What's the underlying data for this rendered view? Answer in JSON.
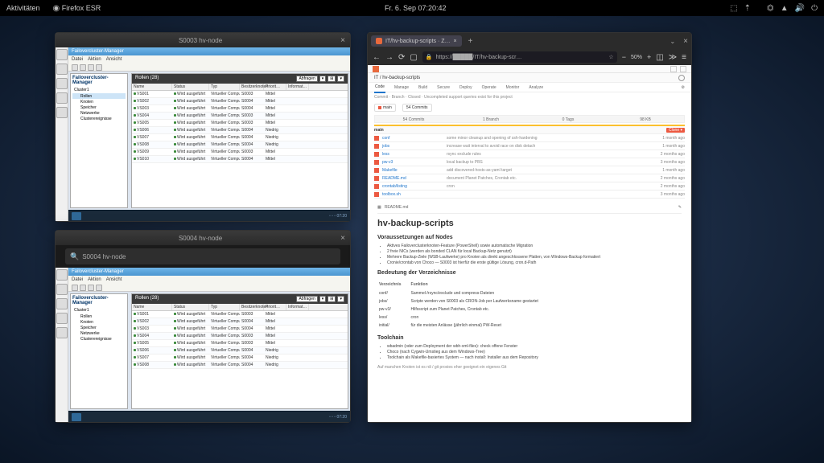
{
  "topbar": {
    "activities": "Aktivitäten",
    "app": "Firefox ESR",
    "datetime": "Fr. 6. Sep  07:20:42"
  },
  "hv1": {
    "title": "S0003 hv-node",
    "breadcrumb": "Failovercluster-Manager",
    "menu": [
      "Datei",
      "Aktion",
      "Ansicht"
    ],
    "tree_title": "Failovercluster-Manager",
    "tree": [
      "Cluster1",
      "Rollen",
      "Knoten",
      "Speicher",
      "Netzwerke",
      "Clusterereignisse"
    ],
    "list_title": "Rollen (28)",
    "filter": "Abfragen",
    "columns": [
      "Name",
      "Status",
      "Typ",
      "Besitzerknoten",
      "Priorit…",
      "Informat…"
    ],
    "rows": [
      [
        "VS001",
        "Wird ausgeführt",
        "Virtueller Computer",
        "S0003",
        "Mittel",
        ""
      ],
      [
        "VS002",
        "Wird ausgeführt",
        "Virtueller Computer",
        "S0004",
        "Mittel",
        ""
      ],
      [
        "VS003",
        "Wird ausgeführt",
        "Virtueller Computer",
        "S0004",
        "Mittel",
        ""
      ],
      [
        "VS004",
        "Wird ausgeführt",
        "Virtueller Computer",
        "S0003",
        "Mittel",
        ""
      ],
      [
        "VS005",
        "Wird ausgeführt",
        "Virtueller Computer",
        "S0003",
        "Mittel",
        ""
      ],
      [
        "VS006",
        "Wird ausgeführt",
        "Virtueller Computer",
        "S0004",
        "Niedrig",
        ""
      ],
      [
        "VS007",
        "Wird ausgeführt",
        "Virtueller Computer",
        "S0004",
        "Niedrig",
        ""
      ],
      [
        "VS008",
        "Wird ausgeführt",
        "Virtueller Computer",
        "S0004",
        "Niedrig",
        ""
      ],
      [
        "VS009",
        "Wird ausgeführt",
        "Virtueller Computer",
        "S0003",
        "Mittel",
        ""
      ],
      [
        "VS010",
        "Wird ausgeführt",
        "Virtueller Computer",
        "S0004",
        "Mittel",
        ""
      ]
    ]
  },
  "hv2": {
    "title": "S0004 hv-node",
    "search": "S0004 hv-node",
    "breadcrumb": "Failovercluster-Manager",
    "menu": [
      "Datei",
      "Aktion",
      "Ansicht"
    ],
    "tree_title": "Failovercluster-Manager",
    "tree": [
      "Cluster1",
      "Rollen",
      "Knoten",
      "Speicher",
      "Netzwerke",
      "Clusterereignisse"
    ],
    "list_title": "Rollen (28)",
    "filter": "Abfragen",
    "columns": [
      "Name",
      "Status",
      "Typ",
      "Besitzerknoten",
      "Priorit…",
      "Informat…"
    ],
    "rows": [
      [
        "VS001",
        "Wird ausgeführt",
        "Virtueller Computer",
        "S0003",
        "Mittel",
        ""
      ],
      [
        "VS002",
        "Wird ausgeführt",
        "Virtueller Computer",
        "S0004",
        "Mittel",
        ""
      ],
      [
        "VS003",
        "Wird ausgeführt",
        "Virtueller Computer",
        "S0004",
        "Mittel",
        ""
      ],
      [
        "VS004",
        "Wird ausgeführt",
        "Virtueller Computer",
        "S0003",
        "Mittel",
        ""
      ],
      [
        "VS005",
        "Wird ausgeführt",
        "Virtueller Computer",
        "S0003",
        "Mittel",
        ""
      ],
      [
        "VS006",
        "Wird ausgeführt",
        "Virtueller Computer",
        "S0004",
        "Niedrig",
        ""
      ],
      [
        "VS007",
        "Wird ausgeführt",
        "Virtueller Computer",
        "S0004",
        "Niedrig",
        ""
      ],
      [
        "VS008",
        "Wird ausgeführt",
        "Virtueller Computer",
        "S0004",
        "Niedrig",
        ""
      ]
    ]
  },
  "firefox": {
    "tab_label": "IT/hv-backup-scripts · Z…",
    "url": "https://█████/IT/hv-backup-scr…",
    "zoom": "50%"
  },
  "gitlab": {
    "breadcrumb": "IT / hv-backup-scripts",
    "tabs": [
      "Code",
      "Manage",
      "Build",
      "Secure",
      "Deploy",
      "Operate",
      "Monitor",
      "Analyze"
    ],
    "active_tab": "Code",
    "subtext": "Commit · Branch · Closed · Uncompleted support queries exist for this project",
    "commits_label": "54 Commits",
    "branch_label": "1 Branch",
    "tags_label": "0 Tags",
    "storage_label": "98 KB",
    "main_branch": "main",
    "files": [
      {
        "name": "conf",
        "msg": "some minor cleanup and opening of ssh-hardening",
        "age": "1 month ago"
      },
      {
        "name": "jobs",
        "msg": "increase wait interval to avoid race on disk detach",
        "age": "1 month ago"
      },
      {
        "name": "less",
        "msg": "rsync exclude rules",
        "age": "2 months ago"
      },
      {
        "name": "pw-v3",
        "msg": "local backup to PBS",
        "age": "3 months ago"
      },
      {
        "name": "Makefile",
        "msg": "add discovered-hosts-as-yaml target",
        "age": "1 month ago"
      },
      {
        "name": "README.md",
        "msg": "document Planet Patches, Crontab etc.",
        "age": "2 months ago"
      },
      {
        "name": "crontab/listing",
        "msg": "cron",
        "age": "2 months ago"
      },
      {
        "name": "toolbox.sh",
        "msg": "",
        "age": "3 months ago"
      }
    ],
    "readme_label": "README.md",
    "h1": "hv-backup-scripts",
    "h2a": "Voraussetzungen auf Nodes",
    "prereqs": [
      "Aktives Failoverclusterknoten-Feature (PowerShell) sowie automatische Migration",
      "2 freie NICs (werden als bonded CLAN für local Backup-Netz genutzt)",
      "Mehrere Backup-Ziele (WSB-Laufwerke) pro Knoten als direkt angeschlossene Platten, von Windows-Backup formatiert",
      "Cronie/crontab von Choco — S0003 ist hierfür die erste gültige Lösung, cron.d-Path"
    ],
    "h2b": "Bedeutung der Verzeichnisse",
    "dir_table_head": [
      "Verzeichnis",
      "Funktion"
    ],
    "dir_table": [
      [
        "conf/",
        "Sammel-/rsync/exclude und compress-Dateien"
      ],
      [
        "jobs/",
        "Scripte werden von S0003 als CRON-Job per Laufwerksname gestartet"
      ],
      [
        "pw-v3/",
        "Hilfsscript zum Planet Patches, Crontab etc."
      ],
      [
        "less/",
        "cron"
      ],
      [
        "initial/",
        "für die meisten Anlässe (jährlich einmal) PW-Reset"
      ]
    ],
    "h2c": "Toolchain",
    "toolchain": [
      "wbadmin (oder zum Deployment der wbh-xml-files): check offene Fenster",
      "Choco (nach Cygwin-Umstieg aus dem Windows-Tree)",
      "Toolchain als Makefile-basiertes System — nach install: Installer aus dem Repository"
    ],
    "footnote": "Auf manchen Knoten ist es rdi / git proxies eher geeignet ein eigenes Git"
  }
}
